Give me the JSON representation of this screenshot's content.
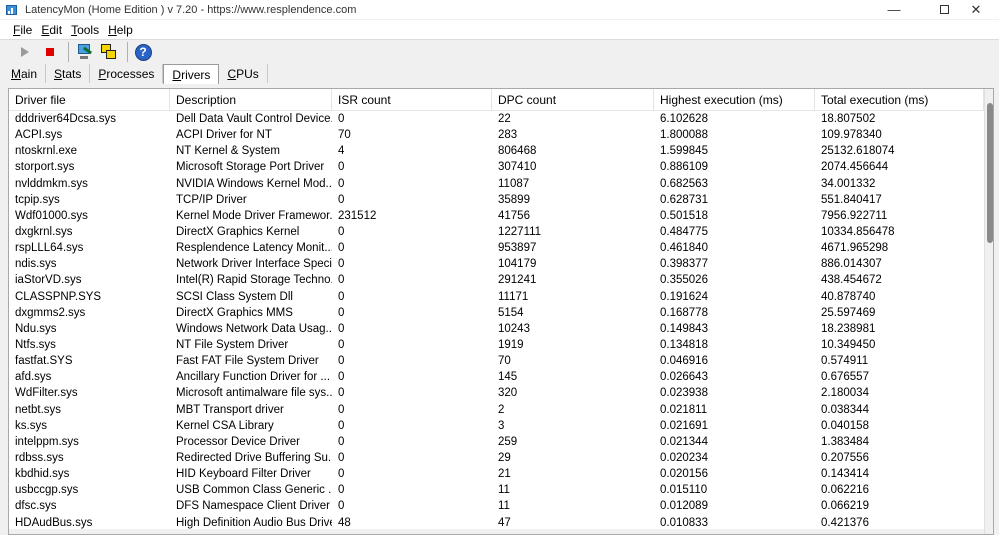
{
  "window": {
    "title": "LatencyMon  (Home Edition )  v 7.20 - https://www.resplendence.com",
    "min_glyph": "—",
    "close_glyph": "✕"
  },
  "menu": [
    {
      "u": "F",
      "rest": "ile"
    },
    {
      "u": "E",
      "rest": "dit"
    },
    {
      "u": "T",
      "rest": "ools"
    },
    {
      "u": "H",
      "rest": "elp"
    }
  ],
  "toolbar": {
    "help_glyph": "?"
  },
  "tabs": [
    {
      "u": "M",
      "rest": "ain",
      "active": false
    },
    {
      "u": "S",
      "rest": "tats",
      "active": false
    },
    {
      "u": "P",
      "rest": "rocesses",
      "active": false
    },
    {
      "u": "D",
      "rest": "rivers",
      "active": true
    },
    {
      "u": "C",
      "rest": "PUs",
      "active": false
    }
  ],
  "table": {
    "columns": [
      "Driver file",
      "Description",
      "ISR count",
      "DPC count",
      "Highest execution (ms)",
      "Total execution (ms)"
    ],
    "rows": [
      [
        "dddriver64Dcsa.sys",
        "Dell Data Vault Control Device...",
        "0",
        "22",
        "6.102628",
        "18.807502"
      ],
      [
        "ACPI.sys",
        "ACPI Driver for NT",
        "70",
        "283",
        "1.800088",
        "109.978340"
      ],
      [
        "ntoskrnl.exe",
        "NT Kernel & System",
        "4",
        "806468",
        "1.599845",
        "25132.618074"
      ],
      [
        "storport.sys",
        "Microsoft Storage Port Driver",
        "0",
        "307410",
        "0.886109",
        "2074.456644"
      ],
      [
        "nvlddmkm.sys",
        "NVIDIA Windows Kernel Mod...",
        "0",
        "11087",
        "0.682563",
        "34.001332"
      ],
      [
        "tcpip.sys",
        "TCP/IP Driver",
        "0",
        "35899",
        "0.628731",
        "551.840417"
      ],
      [
        "Wdf01000.sys",
        "Kernel Mode Driver Framewor...",
        "231512",
        "41756",
        "0.501518",
        "7956.922711"
      ],
      [
        "dxgkrnl.sys",
        "DirectX Graphics Kernel",
        "0",
        "1227111",
        "0.484775",
        "10334.856478"
      ],
      [
        "rspLLL64.sys",
        "Resplendence Latency Monit...",
        "0",
        "953897",
        "0.461840",
        "4671.965298"
      ],
      [
        "ndis.sys",
        "Network Driver Interface Speci...",
        "0",
        "104179",
        "0.398377",
        "886.014307"
      ],
      [
        "iaStorVD.sys",
        "Intel(R) Rapid Storage Techno...",
        "0",
        "291241",
        "0.355026",
        "438.454672"
      ],
      [
        "CLASSPNP.SYS",
        "SCSI Class System Dll",
        "0",
        "11171",
        "0.191624",
        "40.878740"
      ],
      [
        "dxgmms2.sys",
        "DirectX Graphics MMS",
        "0",
        "5154",
        "0.168778",
        "25.597469"
      ],
      [
        "Ndu.sys",
        "Windows Network Data Usag...",
        "0",
        "10243",
        "0.149843",
        "18.238981"
      ],
      [
        "Ntfs.sys",
        "NT File System Driver",
        "0",
        "1919",
        "0.134818",
        "10.349450"
      ],
      [
        "fastfat.SYS",
        "Fast FAT File System Driver",
        "0",
        "70",
        "0.046916",
        "0.574911"
      ],
      [
        "afd.sys",
        "Ancillary Function Driver for ...",
        "0",
        "145",
        "0.026643",
        "0.676557"
      ],
      [
        "WdFilter.sys",
        "Microsoft antimalware file sys...",
        "0",
        "320",
        "0.023938",
        "2.180034"
      ],
      [
        "netbt.sys",
        "MBT Transport driver",
        "0",
        "2",
        "0.021811",
        "0.038344"
      ],
      [
        "ks.sys",
        "Kernel CSA Library",
        "0",
        "3",
        "0.021691",
        "0.040158"
      ],
      [
        "intelppm.sys",
        "Processor Device Driver",
        "0",
        "259",
        "0.021344",
        "1.383484"
      ],
      [
        "rdbss.sys",
        "Redirected Drive Buffering Su...",
        "0",
        "29",
        "0.020234",
        "0.207556"
      ],
      [
        "kbdhid.sys",
        "HID Keyboard Filter Driver",
        "0",
        "21",
        "0.020156",
        "0.143414"
      ],
      [
        "usbccgp.sys",
        "USB Common Class Generic ...",
        "0",
        "11",
        "0.015110",
        "0.062216"
      ],
      [
        "dfsc.sys",
        "DFS Namespace Client Driver",
        "0",
        "11",
        "0.012089",
        "0.066219"
      ],
      [
        "HDAudBus.sys",
        "High Definition Audio Bus Driver",
        "48",
        "47",
        "0.010833",
        "0.421376"
      ]
    ]
  }
}
